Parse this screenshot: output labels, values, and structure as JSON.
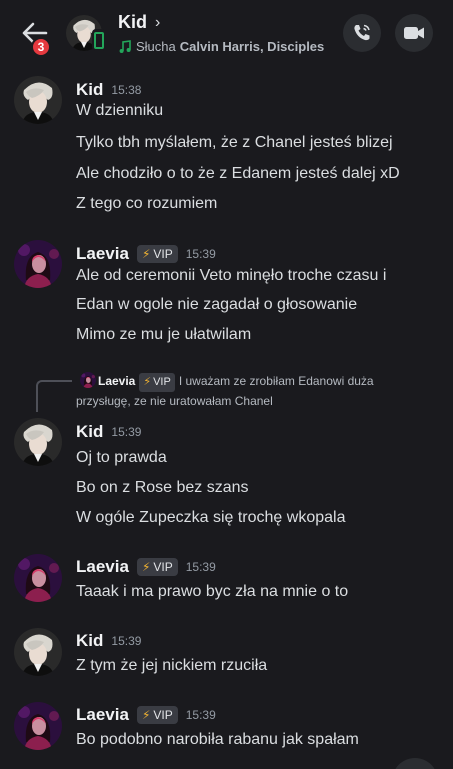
{
  "header": {
    "back_badge": "3",
    "name": "Kid",
    "chevron": "›",
    "status_prefix": "Słucha",
    "status_track": "Calvin Harris,  Disciples",
    "call_icon": "phone-call-icon",
    "video_icon": "video-camera-icon"
  },
  "messages": [
    {
      "author": "Kid",
      "time": "15:38",
      "lines": [
        "W dzienniku",
        "Tylko tbh myślałem, że z Chanel jesteś blizej",
        "Ale chodziło o to że z Edanem jesteś dalej xD",
        "Z tego co rozumiem"
      ]
    },
    {
      "author": "Laevia",
      "vip": "VIP",
      "time": "15:39",
      "lines": [
        "Ale od ceremonii Veto minęło troche czasu i",
        "Edan w ogole nie zagadał o głosowanie",
        "Mimo ze mu je ułatwilam"
      ]
    },
    {
      "reply": {
        "author": "Laevia",
        "vip": "VIP",
        "text": "I uważam ze zrobiłam Edanowi duża przysługę, ze nie uratowałam Chanel"
      },
      "author": "Kid",
      "time": "15:39",
      "lines": [
        "Oj to prawda",
        "Bo on z Rose bez szans",
        "W ogóle Zupeczka się trochę wkopala"
      ]
    },
    {
      "author": "Laevia",
      "vip": "VIP",
      "time": "15:39",
      "lines": [
        "Taaak i ma prawo byc zła na mnie o to"
      ]
    },
    {
      "author": "Kid",
      "time": "15:39",
      "lines": [
        "Z tym że jej nickiem rzuciła"
      ]
    },
    {
      "author": "Laevia",
      "vip": "VIP",
      "time": "15:39",
      "lines": [
        "Bo podobno narobiła rabanu jak spałam"
      ]
    }
  ],
  "colors": {
    "background": "#1a1a1e",
    "badge": "#e5393f",
    "online_green": "#23a55a",
    "vip_bolt": "#f0b232"
  }
}
